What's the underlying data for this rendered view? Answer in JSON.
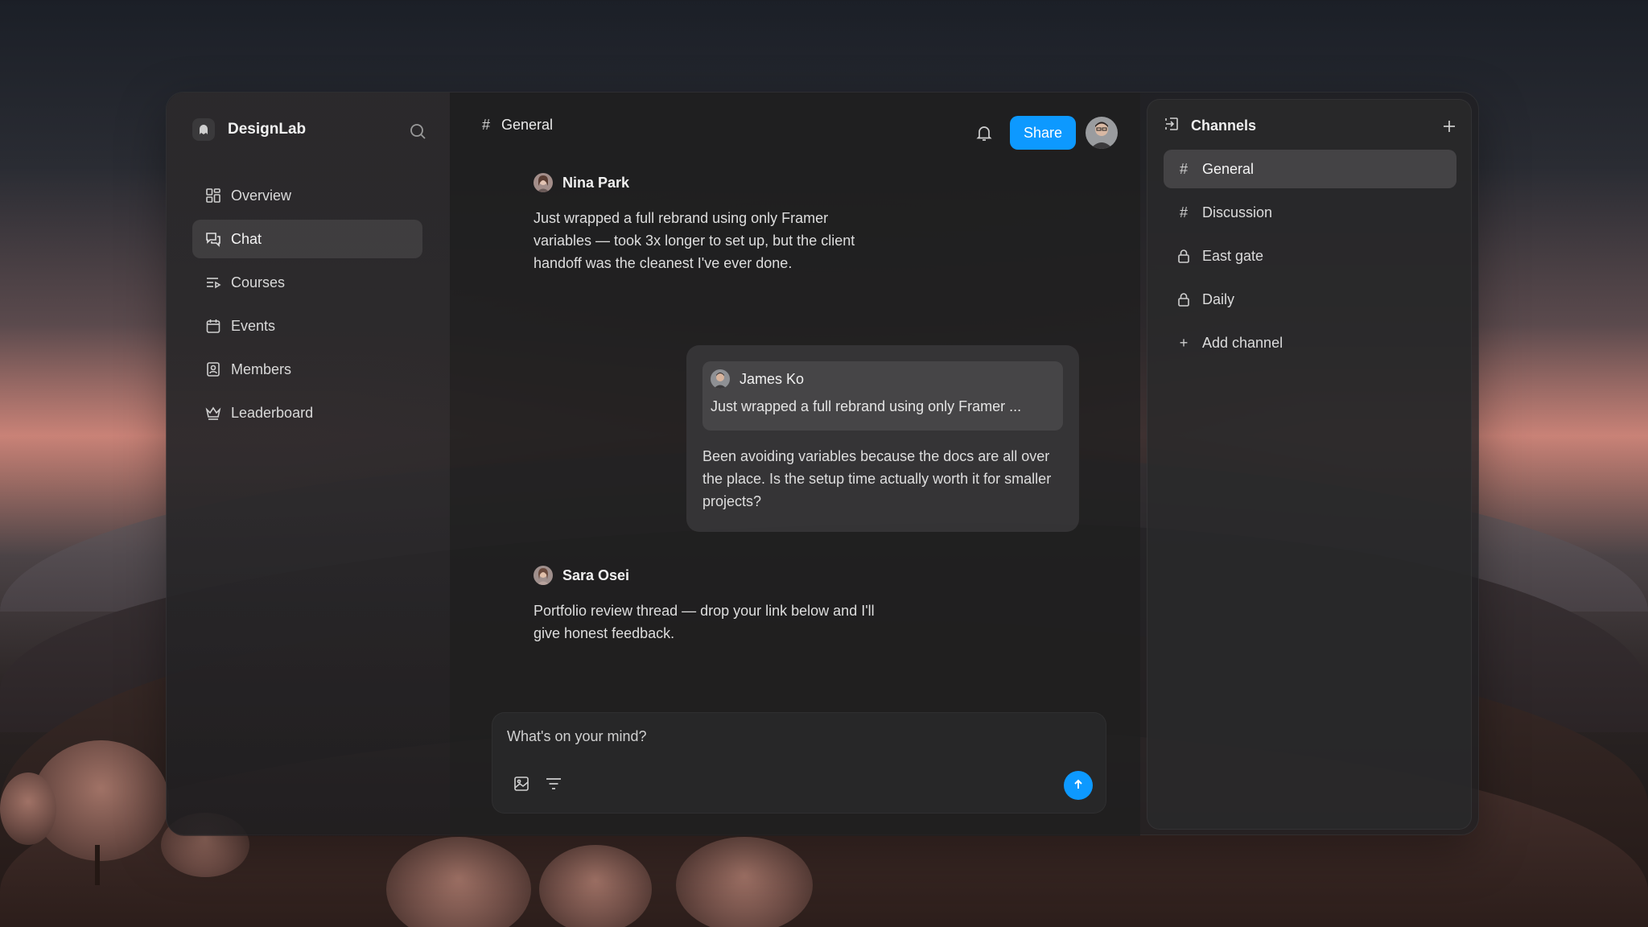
{
  "brand": {
    "name": "DesignLab"
  },
  "sidebar": {
    "items": [
      {
        "label": "Overview",
        "icon": "dashboard-icon"
      },
      {
        "label": "Chat",
        "icon": "chat-icon",
        "active": true
      },
      {
        "label": "Courses",
        "icon": "courses-icon"
      },
      {
        "label": "Events",
        "icon": "calendar-icon"
      },
      {
        "label": "Members",
        "icon": "members-icon"
      },
      {
        "label": "Leaderboard",
        "icon": "crown-icon"
      }
    ]
  },
  "chat": {
    "channel_symbol": "#",
    "title": "General",
    "share_label": "Share",
    "messages": [
      {
        "author": "Nina Park",
        "text": "Just wrapped a full rebrand using only Framer variables — took 3x longer to set up, but the client handoff was the cleanest I've ever done."
      },
      {
        "quote_author": "James Ko",
        "quote_text": "Just wrapped a full rebrand using only Framer ...",
        "text": "Been avoiding variables because the docs are all over the place. Is the setup time actually worth it for smaller projects?"
      },
      {
        "author": "Sara Osei",
        "text": "Portfolio review thread — drop your link below and I'll give honest feedback."
      }
    ],
    "composer": {
      "placeholder": "What's on your mind?"
    }
  },
  "channels": {
    "title": "Channels",
    "items": [
      {
        "symbol": "#",
        "label": "General",
        "active": true
      },
      {
        "symbol": "#",
        "label": "Discussion"
      },
      {
        "symbol": "lock",
        "label": "East gate"
      },
      {
        "symbol": "lock",
        "label": "Daily"
      },
      {
        "symbol": "+",
        "label": "Add channel"
      }
    ]
  },
  "colors": {
    "accent": "#0d99ff",
    "panel": "#2a292b",
    "text": "#ececec"
  }
}
